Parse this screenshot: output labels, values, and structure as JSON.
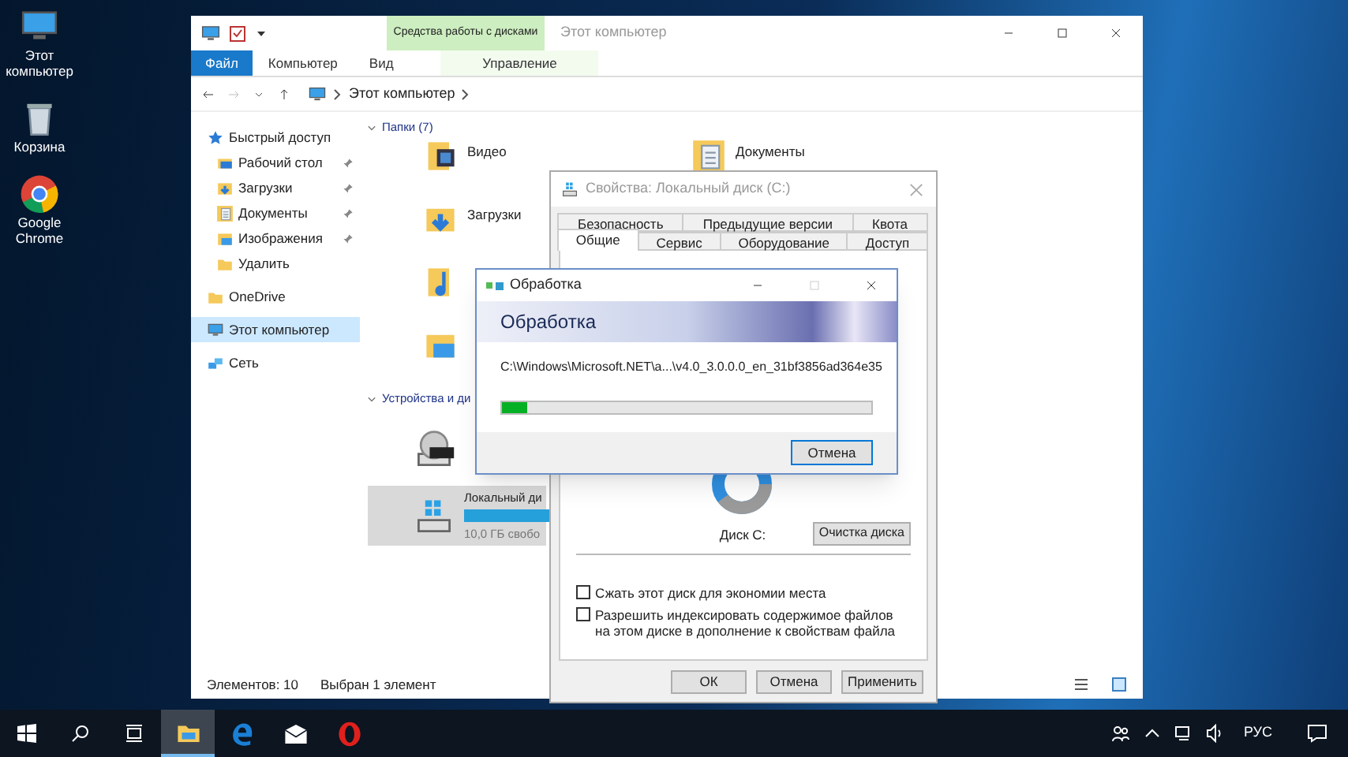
{
  "desktop_icons": [
    {
      "label": "Этот компьютер",
      "kind": "pc"
    },
    {
      "label": "Корзина",
      "kind": "bin"
    },
    {
      "label": "Google Chrome",
      "kind": "chrome"
    }
  ],
  "explorer": {
    "title": "Этот компьютер",
    "context_group": "Средства работы с дисками",
    "ribbon_tabs": [
      {
        "label": "Файл",
        "selected": true
      },
      {
        "label": "Компьютер",
        "selected": false
      },
      {
        "label": "Вид",
        "selected": false
      },
      {
        "label": "Управление",
        "selected": false
      }
    ],
    "address": "Этот компьютер",
    "nav": [
      {
        "label": "Быстрый доступ",
        "kind": "star",
        "selected": false,
        "children": [
          {
            "label": "Рабочий стол",
            "kind": "desktop",
            "pinned": true,
            "selected": false
          },
          {
            "label": "Загрузки",
            "kind": "download",
            "pinned": true,
            "selected": false
          },
          {
            "label": "Документы",
            "kind": "doc",
            "pinned": true,
            "selected": false
          },
          {
            "label": "Изображения",
            "kind": "image",
            "pinned": true,
            "selected": false
          },
          {
            "label": "Удалить",
            "kind": "folder",
            "pinned": false,
            "selected": false
          }
        ]
      },
      {
        "label": "OneDrive",
        "kind": "folder",
        "selected": false
      },
      {
        "label": "Этот компьютер",
        "kind": "pc",
        "selected": true
      },
      {
        "label": "Сеть",
        "kind": "net",
        "selected": false
      }
    ],
    "folders_header": "Папки (7)",
    "folder_columns": [
      [
        {
          "label": "Видео",
          "kind": "video"
        },
        {
          "label": "Загрузки",
          "kind": "download"
        },
        {
          "kind": "music"
        },
        {
          "kind": "image"
        }
      ],
      [
        {
          "label": "Документы",
          "kind": "doc"
        }
      ]
    ],
    "devices_header": "Устройства и ди",
    "drives": [
      {
        "kind": "dvd",
        "selected": false
      },
      {
        "kind": "local",
        "label": "Локальный ди",
        "level": 0.85,
        "free": "10,0 ГБ свобо",
        "selected": true
      }
    ],
    "status": [
      "Элементов: 10",
      "Выбран 1 элемент"
    ]
  },
  "properties": {
    "title": "Свойства: Локальный диск (C:)",
    "tab_rows": [
      [
        {
          "label": "Безопасность",
          "selected": false
        },
        {
          "label": "Предыдущие версии",
          "selected": false
        },
        {
          "label": "Квота",
          "selected": false
        }
      ],
      [
        {
          "label": "Общие",
          "selected": true
        },
        {
          "label": "Сервис",
          "selected": false
        },
        {
          "label": "Оборудование",
          "selected": false
        },
        {
          "label": "Доступ",
          "selected": false
        }
      ]
    ],
    "disk_label": "Диск C:",
    "cleanup_button": "Очистка диска",
    "checkboxes": [
      {
        "label": "Сжать этот диск для экономии места",
        "checked": false
      },
      {
        "label": "Разрешить индексировать содержимое файлов на этом диске в дополнение к свойствам файла",
        "checked": false
      }
    ],
    "buttons": [
      "ОК",
      "Отмена",
      "Применить"
    ]
  },
  "progress": {
    "title": "Обработка",
    "heading": "Обработка",
    "path": "C:\\Windows\\Microsoft.NET\\a...\\v4.0_3.0.0.0_en_31bf3856ad364e35",
    "level": 0.07,
    "cancel": "Отмена"
  },
  "taskbar": {
    "apps": [
      {
        "kind": "explorer",
        "active": true
      },
      {
        "kind": "edge",
        "active": false
      },
      {
        "kind": "mail",
        "active": false
      },
      {
        "kind": "opera",
        "active": false
      }
    ],
    "language": "РУС"
  }
}
